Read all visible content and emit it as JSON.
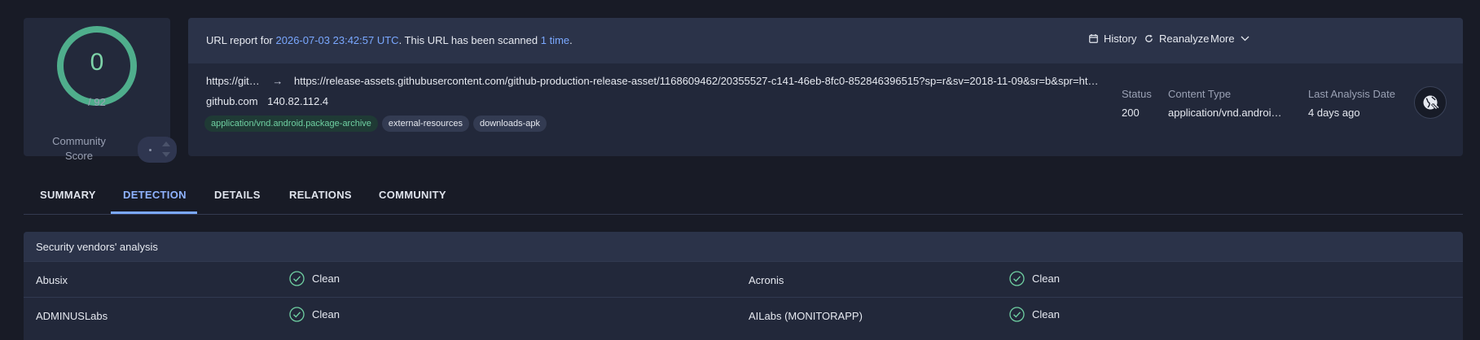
{
  "colors": {
    "accent": "#7aa8ff",
    "score_ring": "#4fae8c",
    "clean": "#6fd0a2"
  },
  "score": {
    "value": "0",
    "total": "/ 92",
    "community_label": "Community Score"
  },
  "report": {
    "intro_prefix": "URL report for",
    "scan_date": "2026-07-03 23:42:57 UTC",
    "intro_middle": ". This URL has been scanned",
    "scan_count": "1 time",
    "intro_suffix": ".",
    "actions": {
      "history": "History",
      "reanalyze": "Reanalyze",
      "more": "More"
    },
    "url_short": "https://git…",
    "url_full": "https://release-assets.githubusercontent.com/github-production-release-asset/1168609462/20355527-c141-46eb-8fc0-852846396515?sp=r&sv=2018-11-09&sr=b&spr=ht…",
    "host": "github.com",
    "ip": "140.82.112.4",
    "tags": [
      "application/vnd.android.package-archive",
      "external-resources",
      "downloads-apk"
    ],
    "meta": {
      "status_label": "Status",
      "status_value": "200",
      "content_type_label": "Content Type",
      "content_type_value": "application/vnd.androi…",
      "last_analysis_label": "Last Analysis Date",
      "last_analysis_value": "4 days ago"
    }
  },
  "tabs": [
    "SUMMARY",
    "DETECTION",
    "DETAILS",
    "RELATIONS",
    "COMMUNITY"
  ],
  "active_tab": "DETECTION",
  "vendors": {
    "title": "Security vendors' analysis",
    "rows": [
      [
        {
          "name": "Abusix",
          "result": "Clean"
        },
        {
          "name": "Acronis",
          "result": "Clean"
        }
      ],
      [
        {
          "name": "ADMINUSLabs",
          "result": "Clean"
        },
        {
          "name": "AILabs (MONITORAPP)",
          "result": "Clean"
        }
      ]
    ]
  }
}
